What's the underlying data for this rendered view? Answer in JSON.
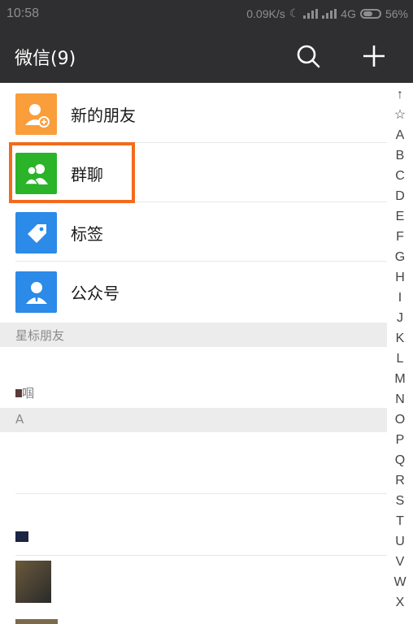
{
  "status_bar": {
    "time": "10:58",
    "speed": "0.09K/s",
    "network": "4G",
    "battery": "56%"
  },
  "header": {
    "title": "微信(9)",
    "search_icon": "search-icon",
    "add_icon": "plus-icon"
  },
  "menu": {
    "items": [
      {
        "label": "新的朋友",
        "icon": "add-friend-icon",
        "color": "#fa9d3b"
      },
      {
        "label": "群聊",
        "icon": "group-chat-icon",
        "color": "#2bb32a"
      },
      {
        "label": "标签",
        "icon": "tag-icon",
        "color": "#2c8ae8"
      },
      {
        "label": "公众号",
        "icon": "official-account-icon",
        "color": "#2c8ae8"
      }
    ]
  },
  "sections": {
    "starred": "星标朋友",
    "a": "A"
  },
  "contacts": {
    "starred_partial": "啯"
  },
  "index": [
    "↑",
    "☆",
    "A",
    "B",
    "C",
    "D",
    "E",
    "F",
    "G",
    "H",
    "I",
    "J",
    "K",
    "L",
    "M",
    "N",
    "O",
    "P",
    "Q",
    "R",
    "S",
    "T",
    "U",
    "V",
    "W",
    "X"
  ],
  "colors": {
    "highlight": "#f26b1d",
    "bar": "#2f2f31"
  }
}
